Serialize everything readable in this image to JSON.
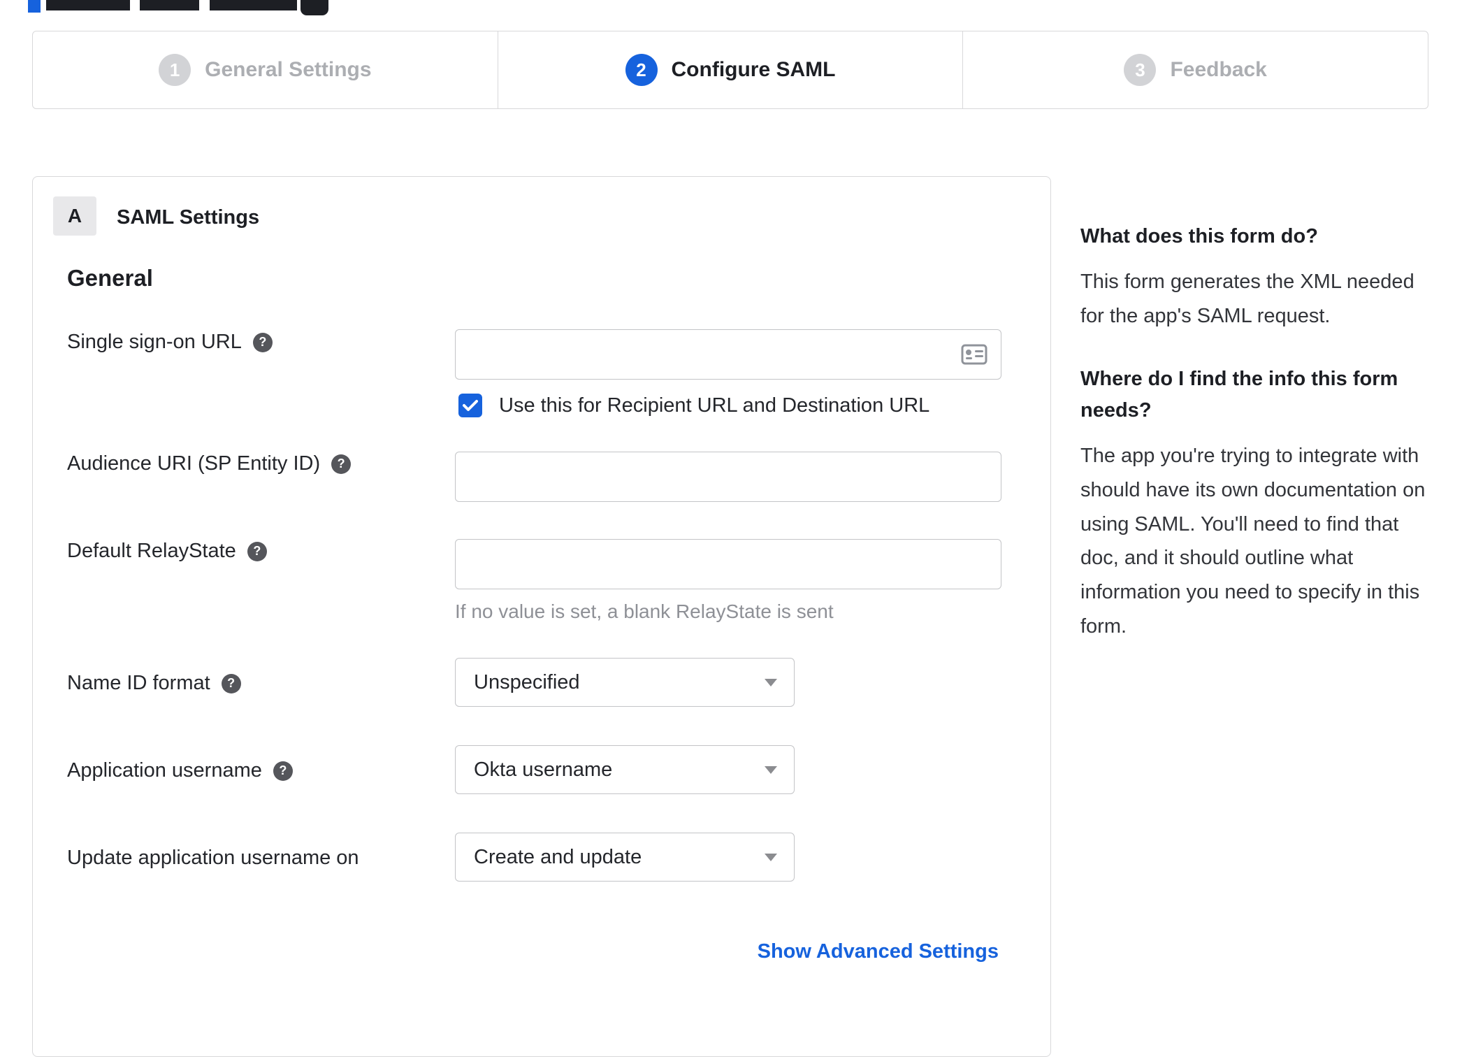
{
  "stepper": {
    "steps": [
      {
        "number": "1",
        "label": "General Settings",
        "state": "inactive"
      },
      {
        "number": "2",
        "label": "Configure SAML",
        "state": "active"
      },
      {
        "number": "3",
        "label": "Feedback",
        "state": "inactive"
      }
    ]
  },
  "form": {
    "section_badge": "A",
    "section_title": "SAML Settings",
    "group_title": "General",
    "fields": {
      "sso_url": {
        "label": "Single sign-on URL",
        "value": "",
        "checkbox_label": "Use this for Recipient URL and Destination URL",
        "checkbox_checked": true
      },
      "audience_uri": {
        "label": "Audience URI (SP Entity ID)",
        "value": ""
      },
      "relay_state": {
        "label": "Default RelayState",
        "value": "",
        "helper": "If no value is set, a blank RelayState is sent"
      },
      "name_id_format": {
        "label": "Name ID format",
        "value": "Unspecified"
      },
      "app_username": {
        "label": "Application username",
        "value": "Okta username"
      },
      "update_username": {
        "label": "Update application username on",
        "value": "Create and update"
      }
    },
    "advanced_link": "Show Advanced Settings",
    "help_icon_glyph": "?"
  },
  "sidebar": {
    "sections": [
      {
        "heading": "What does this form do?",
        "body": "This form generates the XML needed for the app's SAML request."
      },
      {
        "heading": "Where do I find the info this form needs?",
        "body": "The app you're trying to integrate with should have its own documentation on using SAML. You'll need to find that doc, and it should outline what information you need to specify in this form."
      }
    ]
  },
  "colors": {
    "accent": "#1662dd",
    "link": "#1662dd",
    "inactive_step": "#d2d3d6"
  }
}
